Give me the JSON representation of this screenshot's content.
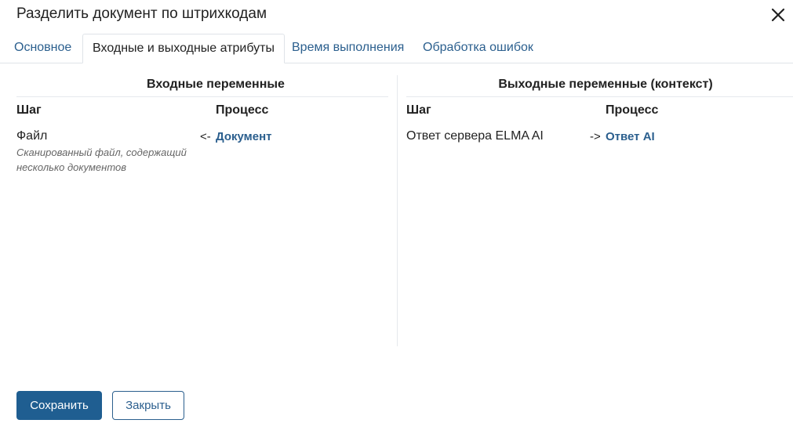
{
  "dialog": {
    "title": "Разделить документ по штрихкодам",
    "close_icon": "close-icon"
  },
  "tabs": [
    {
      "label": "Основное",
      "active": false
    },
    {
      "label": "Входные и выходные атрибуты",
      "active": true
    },
    {
      "label": "Время выполнения",
      "active": false
    },
    {
      "label": "Обработка ошибок",
      "active": false
    }
  ],
  "input": {
    "title": "Входные переменные",
    "col_step": "Шаг",
    "col_process": "Процесс",
    "rows": [
      {
        "step": "Файл",
        "description": "Сканированный файл, содержащий несколько документов",
        "arrow": "<-",
        "process": "Документ"
      }
    ]
  },
  "output": {
    "title": "Выходные переменные (контекст)",
    "col_step": "Шаг",
    "col_process": "Процесс",
    "rows": [
      {
        "step": "Ответ сервера ELMA AI",
        "arrow": "->",
        "process": "Ответ AI"
      }
    ]
  },
  "footer": {
    "save_label": "Сохранить",
    "close_label": "Закрыть"
  },
  "colors": {
    "accent": "#1f5e91",
    "link": "#2b5f8e",
    "divider": "#e6e9ed"
  }
}
